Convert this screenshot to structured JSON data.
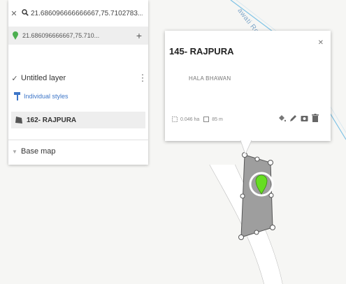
{
  "search": {
    "query": "21.686096666666667,75.7102783...",
    "close_icon": "close-icon",
    "search_icon": "search-icon"
  },
  "result": {
    "coordinates": "21.686096666667,75.710...",
    "pin_color": "#4caf50",
    "add_icon": "plus-icon"
  },
  "layer": {
    "name": "Untitled layer",
    "styles_link": "Individual styles",
    "feature_name": "162- RAJPURA",
    "base_map_label": "Base map"
  },
  "popup": {
    "title": "145- RAJPURA",
    "description": "HALA BHAWAN",
    "area": "0.046 ha",
    "perimeter": "85 m",
    "tools": [
      "paint-bucket-icon",
      "pencil-icon",
      "camera-icon",
      "trash-icon"
    ]
  },
  "map": {
    "road_label": "awati Ro",
    "polygon_fill": "#9e9e9e",
    "marker_color": "#66dd22",
    "road_color": "#7fc3e6"
  }
}
